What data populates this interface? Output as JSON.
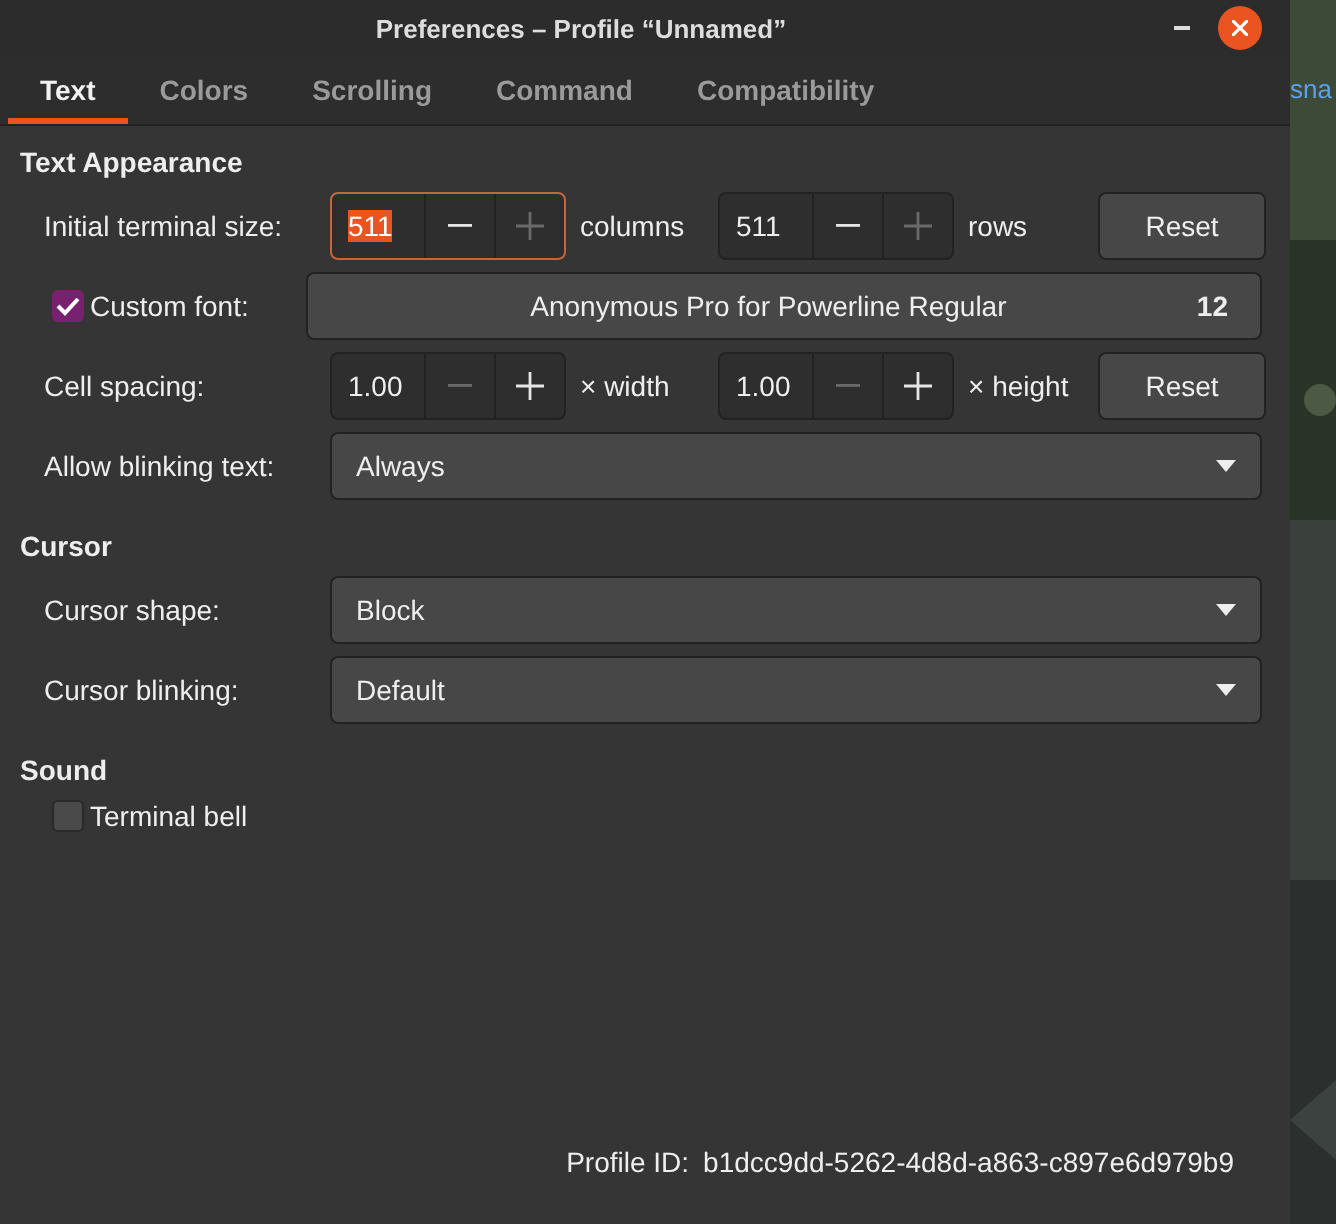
{
  "window": {
    "title": "Preferences – Profile “Unnamed”",
    "controls": [
      {
        "kind": "minimize"
      },
      {
        "kind": "close"
      }
    ]
  },
  "background": {
    "kind": "picture",
    "link_text": "sna"
  },
  "tabs": [
    {
      "label": "Text",
      "selected": true
    },
    {
      "label": "Colors",
      "selected": false
    },
    {
      "label": "Scrolling",
      "selected": false
    },
    {
      "label": "Command",
      "selected": false
    },
    {
      "label": "Compatibility",
      "selected": false
    }
  ],
  "sections": [
    {
      "title": "Text Appearance",
      "rows": [
        {
          "kind": "spins",
          "label": "Initial terminal size:",
          "spins": [
            {
              "value": "511",
              "focused": true,
              "unit": "columns",
              "minus_disabled": false,
              "plus_disabled": true
            },
            {
              "value": "511",
              "focused": false,
              "unit": "rows",
              "minus_disabled": false,
              "plus_disabled": true
            }
          ],
          "button": "Reset"
        },
        {
          "kind": "font",
          "label": "Custom font:",
          "checked": true,
          "font": "Anonymous Pro for Powerline Regular",
          "size": "12"
        },
        {
          "kind": "spins",
          "label": "Cell spacing:",
          "spins": [
            {
              "value": "1.00",
              "focused": false,
              "unit": "× width",
              "minus_disabled": true,
              "plus_disabled": false
            },
            {
              "value": "1.00",
              "focused": false,
              "unit": "× height",
              "minus_disabled": true,
              "plus_disabled": false
            }
          ],
          "button": "Reset"
        },
        {
          "kind": "dropdown",
          "label": "Allow blinking text:",
          "value": "Always"
        }
      ]
    },
    {
      "title": "Cursor",
      "rows": [
        {
          "kind": "dropdown",
          "label": "Cursor shape:",
          "value": "Block"
        },
        {
          "kind": "dropdown",
          "label": "Cursor blinking:",
          "value": "Default"
        }
      ]
    },
    {
      "title": "Sound",
      "rows": [
        {
          "kind": "check",
          "label": "Terminal bell",
          "checked": false
        }
      ]
    }
  ],
  "profile_id": {
    "label": "Profile ID:",
    "value": "b1dcc9dd-5262-4d8d-a863-c897e6d979b9"
  }
}
